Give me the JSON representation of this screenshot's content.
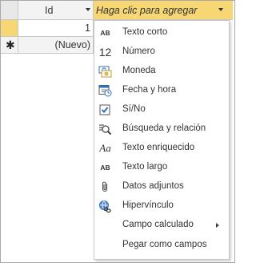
{
  "grid": {
    "columns": [
      {
        "label": "Id"
      },
      {
        "label": "Haga clic para agregar"
      }
    ],
    "rows": [
      {
        "id_value": "1"
      },
      {
        "selector_symbol": "✱",
        "id_value": "(Nuevo)"
      }
    ]
  },
  "menu": {
    "items": [
      {
        "icon": "text-short-icon",
        "icon_text": "AB",
        "label": "Texto corto"
      },
      {
        "icon": "number-icon",
        "icon_text": "12",
        "label": "Número"
      },
      {
        "icon": "currency-icon",
        "label": "Moneda"
      },
      {
        "icon": "calendar-icon",
        "label": "Fecha y hora"
      },
      {
        "icon": "checkbox-icon",
        "label": "Sí/No"
      },
      {
        "icon": "lookup-icon",
        "label": "Búsqueda y relación"
      },
      {
        "icon": "rich-text-icon",
        "icon_text": "Aa",
        "label": "Texto enriquecido"
      },
      {
        "icon": "long-text-icon",
        "icon_text": "AB",
        "label": "Texto largo"
      },
      {
        "icon": "paperclip-icon",
        "label": "Datos adjuntos"
      },
      {
        "icon": "hyperlink-icon",
        "label": "Hipervínculo"
      },
      {
        "icon": "",
        "label": "Campo calculado",
        "has_submenu": true
      },
      {
        "icon": "",
        "label": "Pegar como campos"
      }
    ]
  },
  "colors": {
    "header_highlight": "#f7d774",
    "header_bg": "#f3f3f3",
    "grid_line": "#c8c8c8",
    "icon_blue": "#2f6fb5"
  }
}
